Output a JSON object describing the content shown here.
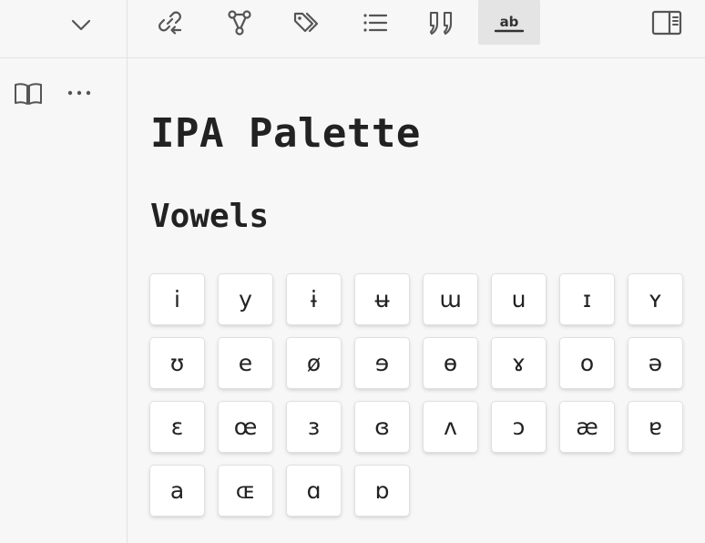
{
  "document": {
    "title": "IPA Palette",
    "section_heading": "Vowels"
  },
  "toolbar": {
    "active_tool": "text-format",
    "icons": [
      "collapse-chevron-icon",
      "backlinks-icon",
      "graph-icon",
      "tags-icon",
      "list-icon",
      "quote-icon",
      "text-format-icon",
      "sidebar-toggle-icon",
      "book-icon",
      "more-icon"
    ]
  },
  "vowels": [
    "i",
    "y",
    "ɨ",
    "ʉ",
    "ɯ",
    "u",
    "ɪ",
    "ʏ",
    "ʊ",
    "e",
    "ø",
    "ɘ",
    "ɵ",
    "ɤ",
    "o",
    "ə",
    "ɛ",
    "œ",
    "ɜ",
    "ɞ",
    "ʌ",
    "ɔ",
    "æ",
    "ɐ",
    "a",
    "ɶ",
    "ɑ",
    "ɒ"
  ]
}
